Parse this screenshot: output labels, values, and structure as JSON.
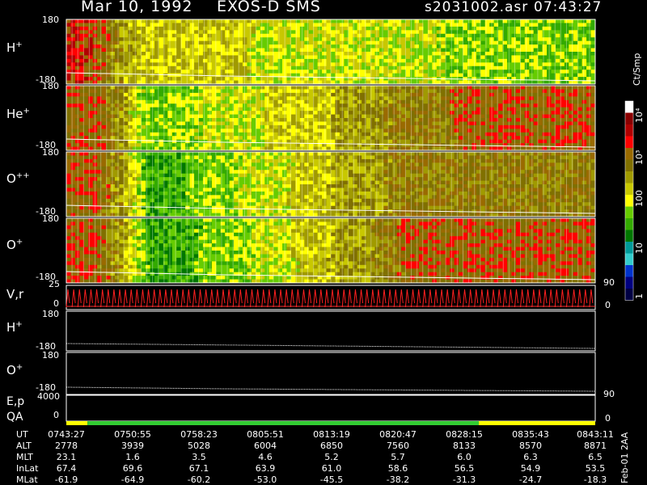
{
  "header": {
    "date": "Mar 10, 1992",
    "instrument": "EXOS-D SMS",
    "file": "s2031002.asr",
    "time": "07:43:27"
  },
  "panels": [
    {
      "label": "H",
      "sup": "+",
      "top_tick": "180",
      "bottom_tick": "-180"
    },
    {
      "label": "He",
      "sup": "+",
      "top_tick": "180",
      "bottom_tick": "-180"
    },
    {
      "label": "O",
      "sup": "++",
      "top_tick": "180",
      "bottom_tick": "-180"
    },
    {
      "label": "O",
      "sup": "+",
      "top_tick": "180",
      "bottom_tick": "-180"
    }
  ],
  "line_panels": {
    "vr": {
      "label": "V,r",
      "top_tick": "25",
      "bottom_tick": "0",
      "right_top": "90",
      "right_bottom": "0"
    },
    "h": {
      "label": "H",
      "sup": "+",
      "top_tick": "180",
      "bottom_tick": "-180"
    },
    "o": {
      "label": "O",
      "sup": "+",
      "top_tick": "180",
      "bottom_tick": "-180"
    },
    "ep": {
      "label": "E,p",
      "top_tick": "4000",
      "bottom_tick": "0",
      "right_top": "90",
      "right_bottom": "0"
    },
    "qa": {
      "label": "QA"
    }
  },
  "colorbar": {
    "unit": "Ct/Smp",
    "labels": [
      "10⁴",
      "10³",
      "100",
      "10",
      "1"
    ],
    "colors": [
      "#ffffff",
      "#8b0000",
      "#b00000",
      "#ff0000",
      "#9a6a00",
      "#807000",
      "#a09a00",
      "#c8c800",
      "#ffff00",
      "#66cc00",
      "#33aa00",
      "#007700",
      "#009999",
      "#33cccc",
      "#0033cc",
      "#000080",
      "#000044"
    ]
  },
  "footer": {
    "rows": [
      {
        "label": "UT",
        "values": [
          "0743:27",
          "0750:55",
          "0758:23",
          "0805:51",
          "0813:19",
          "0820:47",
          "0828:15",
          "0835:43",
          "0843:11"
        ]
      },
      {
        "label": "ALT",
        "values": [
          "2778",
          "3939",
          "5028",
          "6004",
          "6850",
          "7560",
          "8133",
          "8570",
          "8871"
        ]
      },
      {
        "label": "MLT",
        "values": [
          "23.1",
          "1.6",
          "3.5",
          "4.6",
          "5.2",
          "5.7",
          "6.0",
          "6.3",
          "6.5"
        ]
      },
      {
        "label": "InLat",
        "values": [
          "67.4",
          "69.6",
          "67.1",
          "63.9",
          "61.0",
          "58.6",
          "56.5",
          "54.9",
          "53.5"
        ]
      },
      {
        "label": "MLat",
        "values": [
          "-61.9",
          "-64.9",
          "-60.2",
          "-53.0",
          "-45.5",
          "-38.2",
          "-31.3",
          "-24.7",
          "-18.3"
        ]
      }
    ],
    "side_label": "Feb-01 2AA"
  },
  "chart_data": {
    "type": "heatmap",
    "title": "Mar 10, 1992   EXOS-D SMS",
    "xlabel": "UT",
    "x_ticks": [
      "0743:27",
      "0750:55",
      "0758:23",
      "0805:51",
      "0813:19",
      "0820:47",
      "0828:15",
      "0835:43",
      "0843:11"
    ],
    "ylim": [
      -180,
      180
    ],
    "colorbar_unit": "Ct/Smp",
    "colorbar_ticks": [
      "1",
      "10",
      "100",
      "10³",
      "10⁴"
    ],
    "series": [
      {
        "name": "H+",
        "levels": [
          13,
          13,
          12,
          11,
          10,
          9,
          9,
          9,
          9,
          9,
          9,
          9,
          9,
          9,
          8,
          8,
          8,
          8,
          8,
          8,
          8,
          8,
          8,
          8,
          8,
          8,
          8,
          8,
          7,
          7,
          7,
          7,
          7,
          7,
          7,
          7,
          7,
          7,
          7,
          7
        ]
      },
      {
        "name": "He+",
        "levels": [
          12,
          12,
          12,
          11,
          10,
          8,
          7,
          7,
          7,
          7,
          8,
          8,
          8,
          8,
          8,
          9,
          9,
          9,
          9,
          9,
          10,
          10,
          10,
          10,
          11,
          11,
          11,
          11,
          11,
          12,
          12,
          12,
          12,
          12,
          12,
          12,
          12,
          12,
          12,
          12
        ]
      },
      {
        "name": "O++",
        "levels": [
          12,
          12,
          12,
          11,
          10,
          8,
          6,
          6,
          6,
          7,
          7,
          7,
          7,
          8,
          8,
          8,
          8,
          9,
          9,
          9,
          10,
          10,
          10,
          10,
          11,
          11,
          11,
          11,
          11,
          11,
          11,
          11,
          11,
          11,
          11,
          11,
          11,
          11,
          11,
          11
        ]
      },
      {
        "name": "O+",
        "levels": [
          12,
          12,
          12,
          11,
          10,
          8,
          6,
          6,
          6,
          6,
          7,
          7,
          7,
          7,
          8,
          8,
          8,
          9,
          9,
          9,
          10,
          10,
          10,
          11,
          11,
          12,
          12,
          12,
          12,
          12,
          12,
          12,
          12,
          12,
          12,
          12,
          12,
          12,
          12,
          12
        ]
      }
    ],
    "qa_segments": [
      {
        "from": 0,
        "to": 0.04,
        "color": "#ffff00"
      },
      {
        "from": 0.04,
        "to": 0.78,
        "color": "#33cc33"
      },
      {
        "from": 0.78,
        "to": 1,
        "color": "#ffff00"
      }
    ]
  }
}
